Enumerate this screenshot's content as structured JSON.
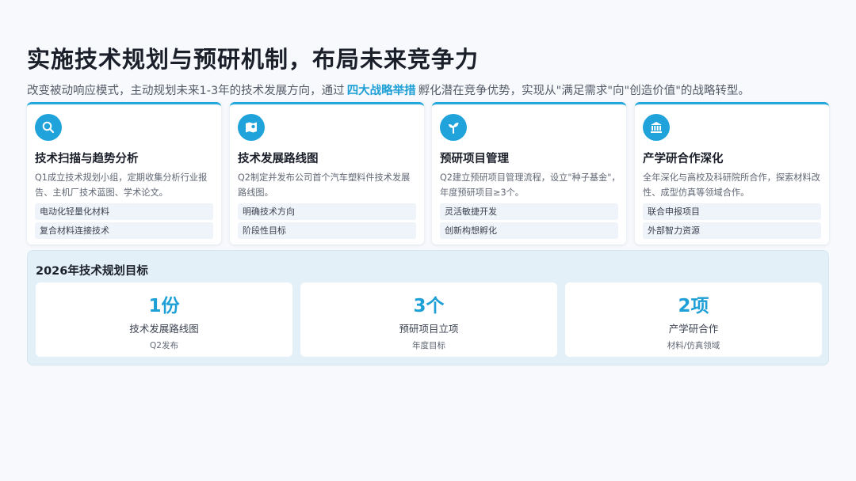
{
  "header": {
    "title": "实施技术规划与预研机制，布局未来竞争力",
    "subtitle_before": "改变被动响应模式，主动规划未来1-3年的技术发展方向，通过",
    "subtitle_highlight": "四大战略举措",
    "subtitle_after": "孵化潜在竞争优势，实现从\"满足需求\"向\"创造价值\"的战略转型。"
  },
  "colors": {
    "accent": "#1fa3da",
    "highlight": "#1e9fd6"
  },
  "cards": [
    {
      "icon": "search-icon",
      "title": "技术扫描与趋势分析",
      "desc": "Q1成立技术规划小组，定期收集分析行业报告、主机厂技术蓝图、学术论文。",
      "tags": [
        "电动化轻量化材料",
        "复合材料连接技术"
      ]
    },
    {
      "icon": "map-icon",
      "title": "技术发展路线图",
      "desc": "Q2制定并发布公司首个汽车塑料件技术发展路线图。",
      "tags": [
        "明确技术方向",
        "阶段性目标"
      ]
    },
    {
      "icon": "seedling-icon",
      "title": "预研项目管理",
      "desc": "Q2建立预研项目管理流程，设立\"种子基金\"，年度预研项目≥3个。",
      "tags": [
        "灵活敏捷开发",
        "创新构想孵化"
      ]
    },
    {
      "icon": "institution-icon",
      "title": "产学研合作深化",
      "desc": "全年深化与高校及科研院所合作，探索材料改性、成型仿真等领域合作。",
      "tags": [
        "联合申报项目",
        "外部智力资源"
      ]
    }
  ],
  "goals": {
    "title": "2026年技术规划目标",
    "items": [
      {
        "value": "1份",
        "label": "技术发展路线图",
        "sub": "Q2发布"
      },
      {
        "value": "3个",
        "label": "预研项目立项",
        "sub": "年度目标"
      },
      {
        "value": "2项",
        "label": "产学研合作",
        "sub": "材料/仿真领域"
      }
    ]
  }
}
